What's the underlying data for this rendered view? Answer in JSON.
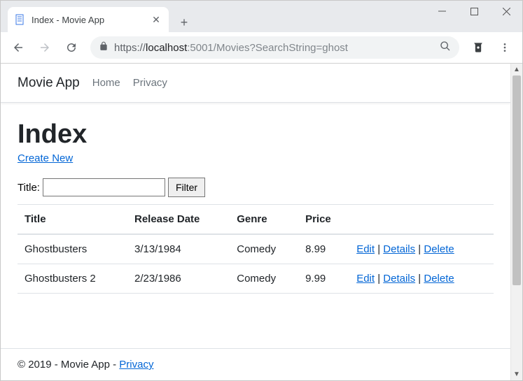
{
  "window": {
    "tab_title": "Index - Movie App",
    "url_scheme": "https://",
    "url_host_main": "localhost",
    "url_host_port": ":5001",
    "url_path": "/Movies?SearchString=ghost"
  },
  "site": {
    "brand": "Movie App",
    "nav": {
      "home": "Home",
      "privacy": "Privacy"
    }
  },
  "page": {
    "heading": "Index",
    "create_link": "Create New",
    "filter_label": "Title:",
    "filter_button": "Filter",
    "filter_value": ""
  },
  "table": {
    "headers": {
      "title": "Title",
      "release": "Release Date",
      "genre": "Genre",
      "price": "Price"
    },
    "rows": [
      {
        "title": "Ghostbusters",
        "release": "3/13/1984",
        "genre": "Comedy",
        "price": "8.99"
      },
      {
        "title": "Ghostbusters 2",
        "release": "2/23/1986",
        "genre": "Comedy",
        "price": "9.99"
      }
    ],
    "actions": {
      "edit": "Edit",
      "details": "Details",
      "delete": "Delete",
      "sep": " | "
    }
  },
  "footer": {
    "text": "© 2019 - Movie App - ",
    "privacy": "Privacy"
  }
}
